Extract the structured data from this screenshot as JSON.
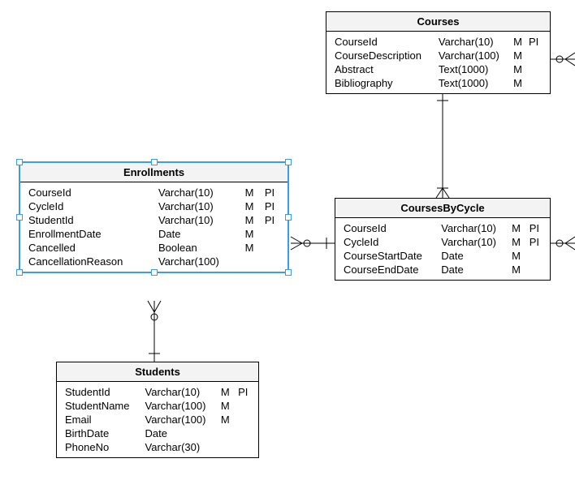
{
  "entities": {
    "courses": {
      "title": "Courses",
      "rows": [
        {
          "name": "CourseId",
          "type": "Varchar(10)",
          "m": "M",
          "pi": "PI"
        },
        {
          "name": "CourseDescription",
          "type": "Varchar(100)",
          "m": "M",
          "pi": ""
        },
        {
          "name": "Abstract",
          "type": "Text(1000)",
          "m": "M",
          "pi": ""
        },
        {
          "name": "Bibliography",
          "type": "Text(1000)",
          "m": "M",
          "pi": ""
        }
      ]
    },
    "coursesByCycle": {
      "title": "CoursesByCycle",
      "rows": [
        {
          "name": "CourseId",
          "type": "Varchar(10)",
          "m": "M",
          "pi": "PI"
        },
        {
          "name": "CycleId",
          "type": "Varchar(10)",
          "m": "M",
          "pi": "PI"
        },
        {
          "name": "CourseStartDate",
          "type": "Date",
          "m": "M",
          "pi": ""
        },
        {
          "name": "CourseEndDate",
          "type": "Date",
          "m": "M",
          "pi": ""
        }
      ]
    },
    "enrollments": {
      "title": "Enrollments",
      "rows": [
        {
          "name": "CourseId",
          "type": "Varchar(10)",
          "m": "M",
          "pi": "PI"
        },
        {
          "name": "CycleId",
          "type": "Varchar(10)",
          "m": "M",
          "pi": "PI"
        },
        {
          "name": "StudentId",
          "type": "Varchar(10)",
          "m": "M",
          "pi": "PI"
        },
        {
          "name": "EnrollmentDate",
          "type": "Date",
          "m": "M",
          "pi": ""
        },
        {
          "name": "Cancelled",
          "type": "Boolean",
          "m": "M",
          "pi": ""
        },
        {
          "name": "CancellationReason",
          "type": "Varchar(100)",
          "m": "",
          "pi": ""
        }
      ]
    },
    "students": {
      "title": "Students",
      "rows": [
        {
          "name": "StudentId",
          "type": "Varchar(10)",
          "m": "M",
          "pi": "PI"
        },
        {
          "name": "StudentName",
          "type": "Varchar(100)",
          "m": "M",
          "pi": ""
        },
        {
          "name": "Email",
          "type": "Varchar(100)",
          "m": "M",
          "pi": ""
        },
        {
          "name": "BirthDate",
          "type": "Date",
          "m": "",
          "pi": ""
        },
        {
          "name": "PhoneNo",
          "type": "Varchar(30)",
          "m": "",
          "pi": ""
        }
      ]
    }
  }
}
